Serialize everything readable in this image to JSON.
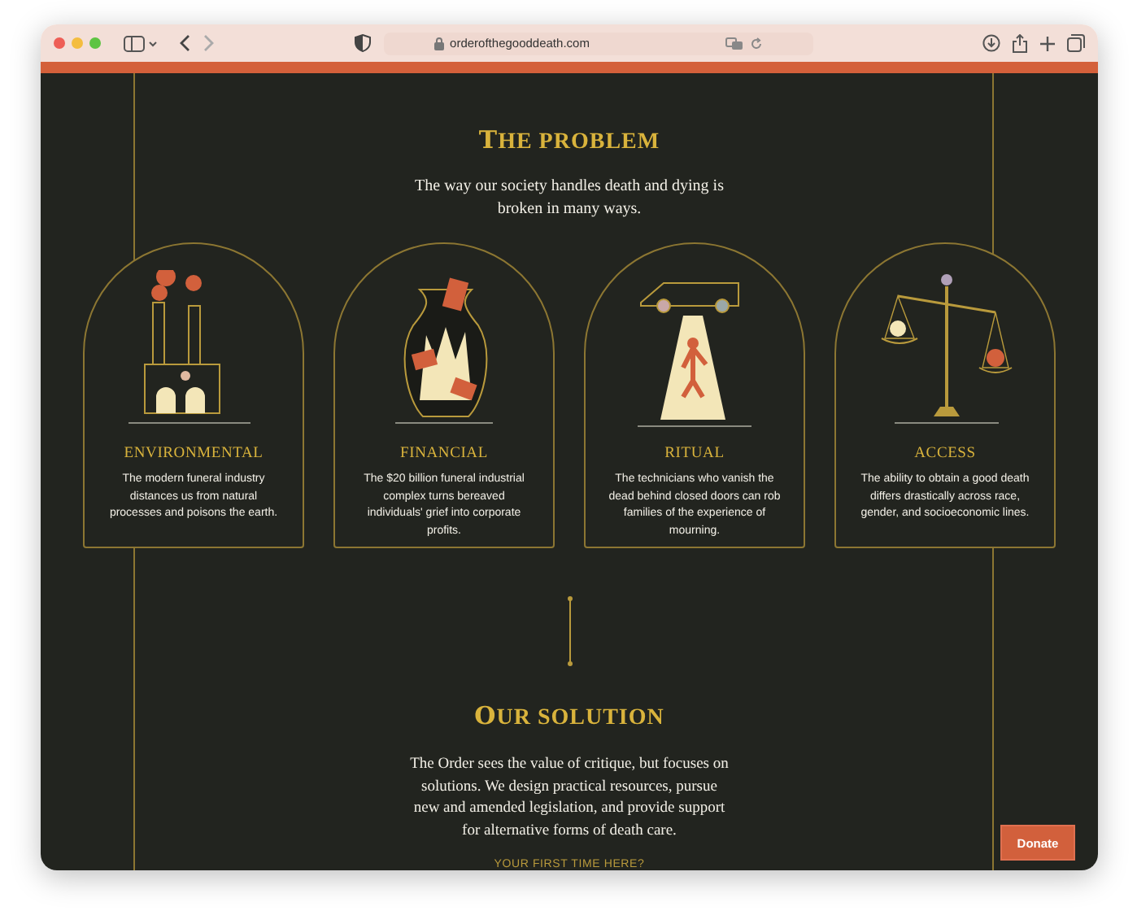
{
  "browser": {
    "url": "orderofthegooddeath.com"
  },
  "problem": {
    "heading": "THE PROBLEM",
    "intro": "The way our society handles death and dying is broken in many ways.",
    "cards": [
      {
        "title": "ENVIRONMENTAL",
        "text": "The modern funeral industry distances us from natural processes and poisons the earth."
      },
      {
        "title": "FINANCIAL",
        "text": "The $20 billion funeral industrial complex turns bereaved individuals' grief into corporate profits."
      },
      {
        "title": "RITUAL",
        "text": "The technicians who vanish the dead behind closed doors can rob families of the experience of mourning."
      },
      {
        "title": "ACCESS",
        "text": "The ability to obtain a good death differs drastically across race, gender, and socioeconomic lines."
      }
    ]
  },
  "solution": {
    "heading": "OUR SOLUTION",
    "text": "The Order sees the value of critique, but focuses on solutions. We design practical resources, pursue new and amended legislation, and provide support for alternative forms of death care.",
    "link": "YOUR FIRST TIME HERE?"
  },
  "donate_button": "Donate"
}
